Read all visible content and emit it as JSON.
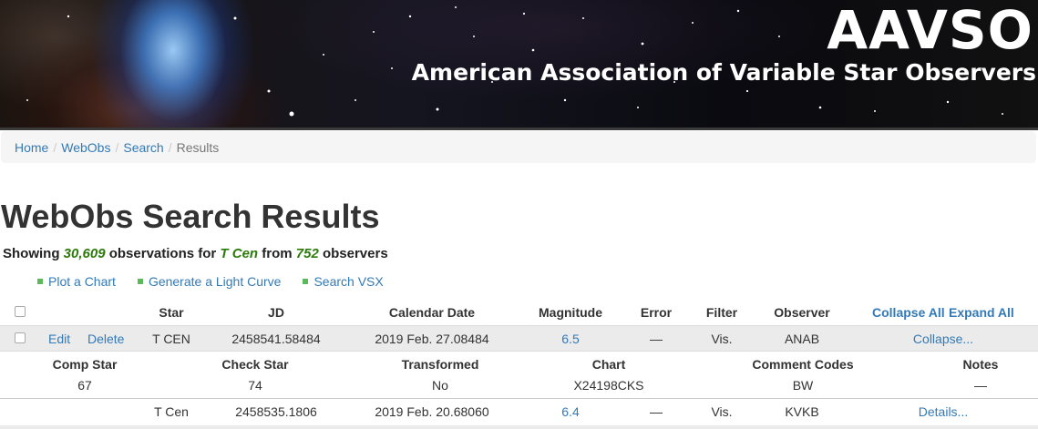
{
  "header": {
    "logo": "AAVSO",
    "org_name": "American Association of Variable Star Observers"
  },
  "breadcrumb": {
    "home": "Home",
    "webobs": "WebObs",
    "search": "Search",
    "current": "Results",
    "separator": "/"
  },
  "page": {
    "title": "WebObs Search Results",
    "summary_prefix": "Showing ",
    "obs_count": "30,609",
    "summary_mid1": " observations for ",
    "star_name": "T Cen",
    "summary_mid2": " from ",
    "observer_count": "752",
    "summary_suffix": " observers"
  },
  "actions": {
    "plot_chart": "Plot a Chart",
    "light_curve": "Generate a Light Curve",
    "search_vsx": "Search VSX"
  },
  "table": {
    "headers": {
      "star": "Star",
      "jd": "JD",
      "calendar_date": "Calendar Date",
      "magnitude": "Magnitude",
      "error": "Error",
      "filter": "Filter",
      "observer": "Observer",
      "collapse_all": "Collapse All",
      "expand_all": "Expand All"
    },
    "rows": [
      {
        "edit": "Edit",
        "delete": "Delete",
        "star": "T CEN",
        "jd": "2458541.58484",
        "calendar_date": "2019 Feb. 27.08484",
        "magnitude": "6.5",
        "error": "—",
        "filter": "Vis.",
        "observer": "ANAB",
        "toggle": "Collapse...",
        "details": {
          "headers": {
            "comp_star": "Comp Star",
            "check_star": "Check Star",
            "transformed": "Transformed",
            "chart": "Chart",
            "comment_codes": "Comment Codes",
            "notes": "Notes"
          },
          "comp_star": "67",
          "check_star": "74",
          "transformed": "No",
          "chart": "X24198CKS",
          "comment_codes": "BW",
          "notes": "—"
        }
      },
      {
        "star": "T Cen",
        "jd": "2458535.1806",
        "calendar_date": "2019 Feb. 20.68060",
        "magnitude": "6.4",
        "error": "—",
        "filter": "Vis.",
        "observer": "KVKB",
        "toggle": "Details..."
      }
    ]
  },
  "colors": {
    "link": "#337ab7",
    "highlight": "#2b7a0b",
    "bullet": "#5cb85c"
  }
}
